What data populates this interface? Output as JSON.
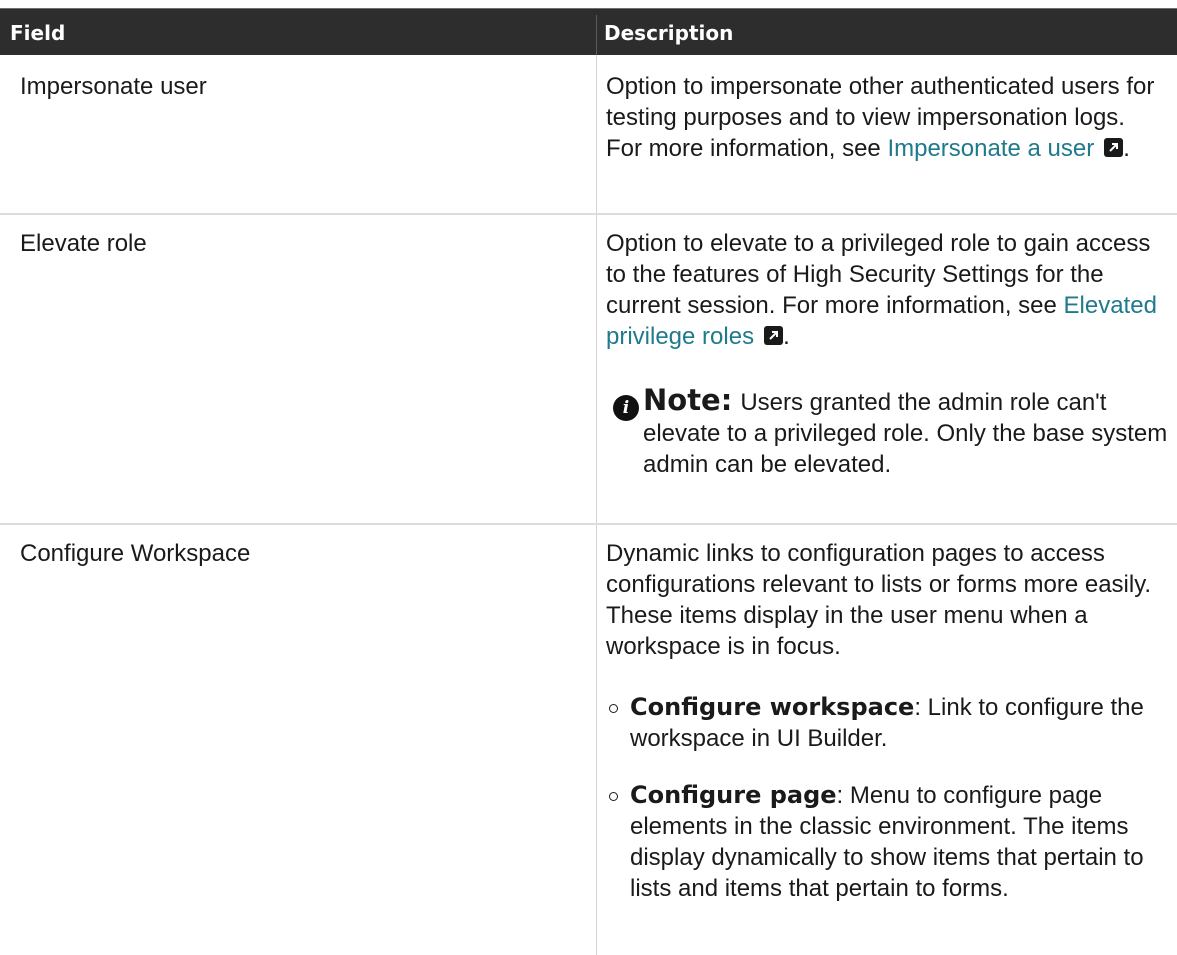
{
  "table": {
    "headers": {
      "field": "Field",
      "description": "Description"
    },
    "rows": [
      {
        "field": "Impersonate user",
        "description": {
          "text": "Option to impersonate other authenticated users for testing purposes and to view impersonation logs. For more information, see ",
          "link": "Impersonate a user",
          "after": "."
        }
      },
      {
        "field": "Elevate role",
        "description": {
          "text": "Option to elevate to a privileged role to gain access to the features of High Security Settings for the current session. For more information, see ",
          "link": "Elevated privilege roles",
          "after": "."
        },
        "note": {
          "label": "Note:",
          "text": "Users granted the admin role can't elevate to a privileged role. Only the base system admin can be elevated."
        }
      },
      {
        "field": "Configure Workspace",
        "description": {
          "text": "Dynamic links to configuration pages to access configurations relevant to lists or forms more easily. These items display in the user menu when a workspace is in focus."
        },
        "bullets": [
          {
            "term": "Configure workspace",
            "text": ": Link to configure the workspace in UI Builder."
          },
          {
            "term": "Configure page",
            "text": ": Menu to configure page elements in the classic environment. The items display dynamically to show items that pertain to lists and items that pertain to forms."
          }
        ]
      }
    ]
  },
  "icons": {
    "external_link": "external-link-icon",
    "note": "info-icon",
    "bullet": "hollow-circle-bullet-icon"
  },
  "colors": {
    "header_bg": "#2d2d2d",
    "link": "#1f7a8c"
  }
}
